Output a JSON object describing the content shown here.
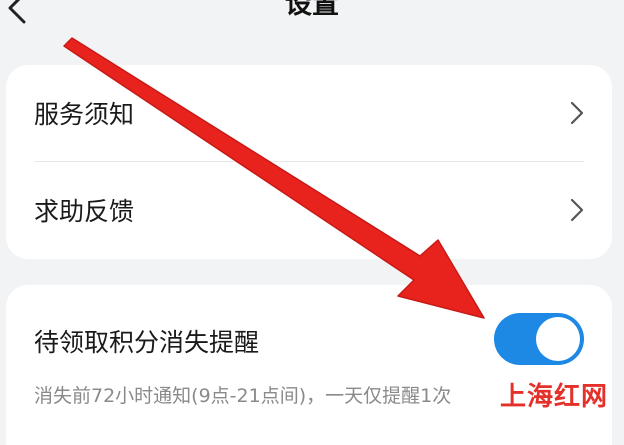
{
  "header": {
    "title": "设置"
  },
  "card1": {
    "items": [
      {
        "label": "服务须知"
      },
      {
        "label": "求助反馈"
      }
    ]
  },
  "card2": {
    "toggle_label": "待领取积分消失提醒",
    "toggle_on": true,
    "description": "消失前72小时通知(9点-21点间)，一天仅提醒1次"
  },
  "watermark": {
    "text": "上海红网"
  },
  "colors": {
    "background": "#f2f3f5",
    "card": "#ffffff",
    "toggle_on": "#1e88e5",
    "annotation_arrow": "#e8231e",
    "watermark": "#e5302a"
  }
}
